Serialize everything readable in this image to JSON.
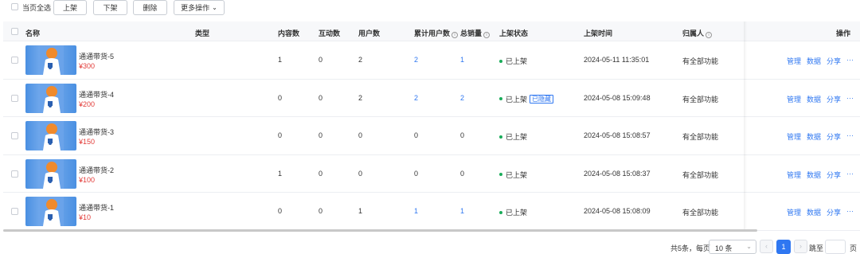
{
  "toolbar": {
    "select_page_all": "当页全选",
    "list_button": "上架",
    "delist_button": "下架",
    "delete_button": "删除",
    "more_actions": "更多操作"
  },
  "table": {
    "headers": {
      "name": "名称",
      "type": "类型",
      "content_count": "内容数",
      "interaction_count": "互动数",
      "user_count": "用户数",
      "cumulative_users": "累计用户数",
      "total_sales": "总销量",
      "listing_status": "上架状态",
      "listing_time": "上架时间",
      "owner": "归属人",
      "operations": "操作"
    },
    "info_icon": "ⓘ",
    "rows": [
      {
        "name": "通通带货-5",
        "price": "¥300",
        "content": "1",
        "interaction": "0",
        "users": "2",
        "cumulative": "2",
        "sales": "1",
        "status": "已上架",
        "tag": "",
        "time": "2024-05-11 11:35:01",
        "owner": "有全部功能"
      },
      {
        "name": "通通带货-4",
        "price": "¥200",
        "content": "0",
        "interaction": "0",
        "users": "2",
        "cumulative": "2",
        "sales": "2",
        "status": "已上架",
        "tag": "已隐藏",
        "time": "2024-05-08 15:09:48",
        "owner": "有全部功能"
      },
      {
        "name": "通通带货-3",
        "price": "¥150",
        "content": "0",
        "interaction": "0",
        "users": "0",
        "cumulative": "0",
        "sales": "0",
        "status": "已上架",
        "tag": "",
        "time": "2024-05-08 15:08:57",
        "owner": "有全部功能"
      },
      {
        "name": "通通带货-2",
        "price": "¥100",
        "content": "1",
        "interaction": "0",
        "users": "0",
        "cumulative": "0",
        "sales": "0",
        "status": "已上架",
        "tag": "",
        "time": "2024-05-08 15:08:37",
        "owner": "有全部功能"
      },
      {
        "name": "通通带货-1",
        "price": "¥10",
        "content": "0",
        "interaction": "0",
        "users": "1",
        "cumulative": "1",
        "sales": "1",
        "status": "已上架",
        "tag": "",
        "time": "2024-05-08 15:08:09",
        "owner": "有全部功能"
      }
    ],
    "actions": {
      "manage": "管理",
      "data": "数据",
      "share": "分享",
      "more": "···"
    }
  },
  "pagination": {
    "total_text": "共5条，每页",
    "page_size": "10 条",
    "prev": "‹",
    "current_page": "1",
    "next": "›",
    "goto_label": "跳至",
    "page_label": "页"
  },
  "colors": {
    "link": "#2f77f1",
    "price": "#e23c39",
    "status_dot": "#1aac5a"
  }
}
